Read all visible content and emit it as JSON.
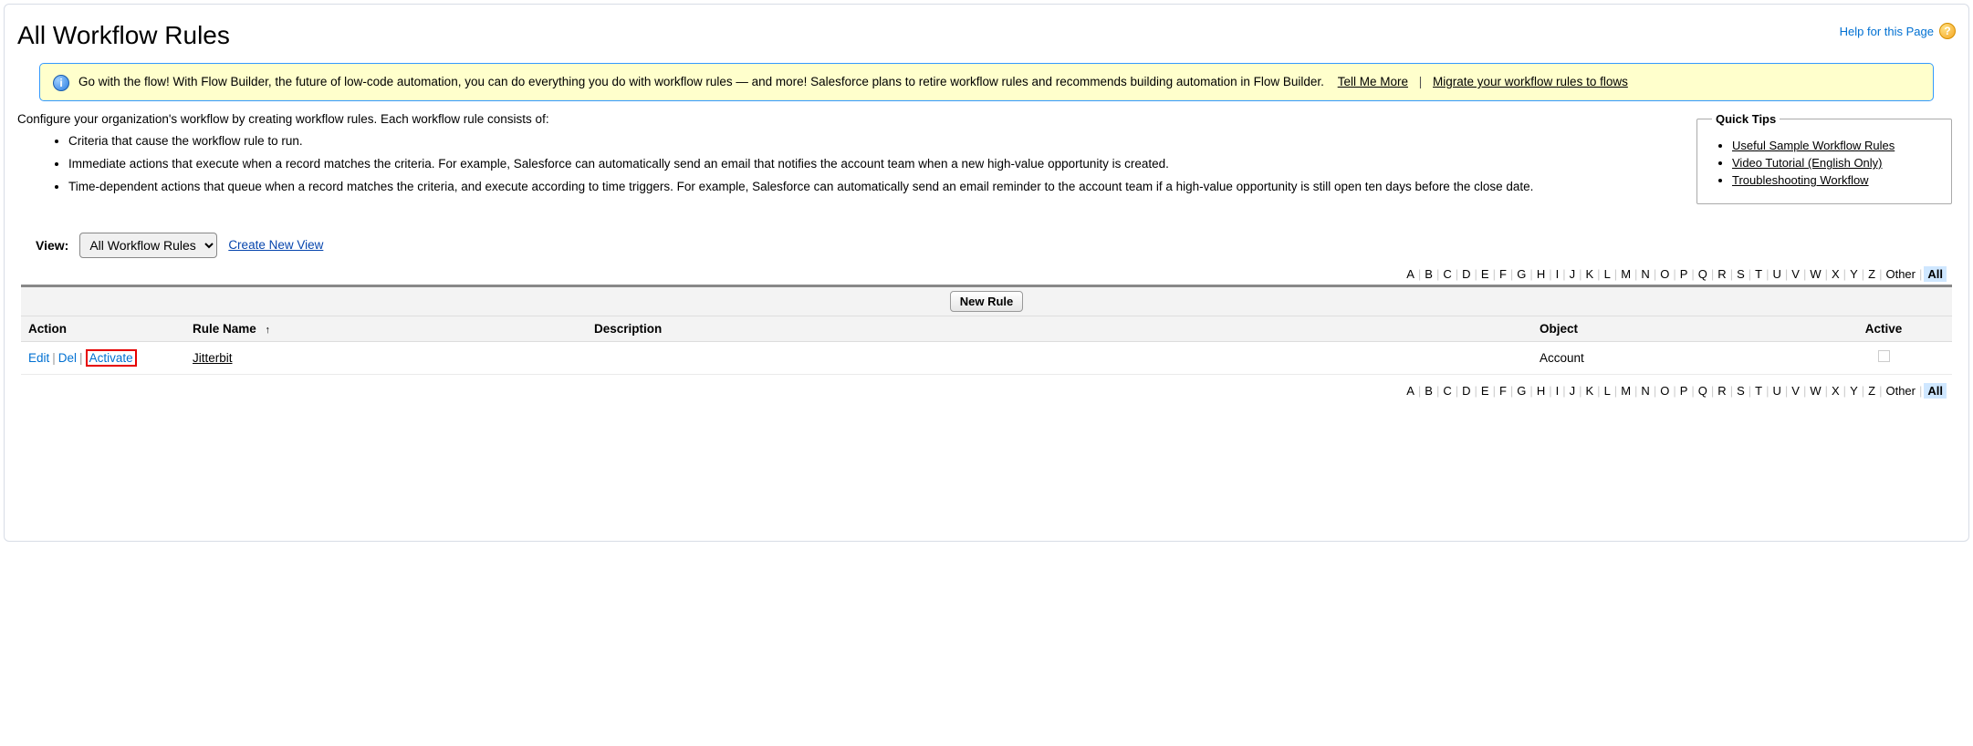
{
  "header": {
    "title": "All Workflow Rules",
    "help_label": "Help for this Page"
  },
  "banner": {
    "text_1": "Go with the flow! With Flow Builder, the future of low-code automation, you can do everything you do with workflow rules — and more! Salesforce plans to retire workflow rules and recommends building automation in Flow Builder.",
    "link_tell_me_more": "Tell Me More",
    "link_migrate": "Migrate your workflow rules to flows"
  },
  "intro": {
    "lead": "Configure your organization's workflow by creating workflow rules. Each workflow rule consists of:",
    "bullet_1": "Criteria that cause the workflow rule to run.",
    "bullet_2": "Immediate actions that execute when a record matches the criteria. For example, Salesforce can automatically send an email that notifies the account team when a new high-value opportunity is created.",
    "bullet_3": "Time-dependent actions that queue when a record matches the criteria, and execute according to time triggers. For example, Salesforce can automatically send an email reminder to the account team if a high-value opportunity is still open ten days before the close date."
  },
  "quick_tips": {
    "legend": "Quick Tips",
    "links": [
      "Useful Sample Workflow Rules",
      "Video Tutorial (English Only)",
      "Troubleshooting Workflow"
    ]
  },
  "view": {
    "label": "View:",
    "selected": "All Workflow Rules",
    "create_link": "Create New View"
  },
  "alpha": {
    "letters": [
      "A",
      "B",
      "C",
      "D",
      "E",
      "F",
      "G",
      "H",
      "I",
      "J",
      "K",
      "L",
      "M",
      "N",
      "O",
      "P",
      "Q",
      "R",
      "S",
      "T",
      "U",
      "V",
      "W",
      "X",
      "Y",
      "Z"
    ],
    "other": "Other",
    "all": "All"
  },
  "list": {
    "new_rule_button": "New Rule",
    "columns": {
      "action": "Action",
      "rule_name": "Rule Name",
      "description": "Description",
      "object": "Object",
      "active": "Active"
    },
    "action_labels": {
      "edit": "Edit",
      "del": "Del",
      "activate": "Activate"
    },
    "rows": [
      {
        "rule_name": "Jitterbit",
        "description": "",
        "object": "Account",
        "active": false
      }
    ]
  }
}
